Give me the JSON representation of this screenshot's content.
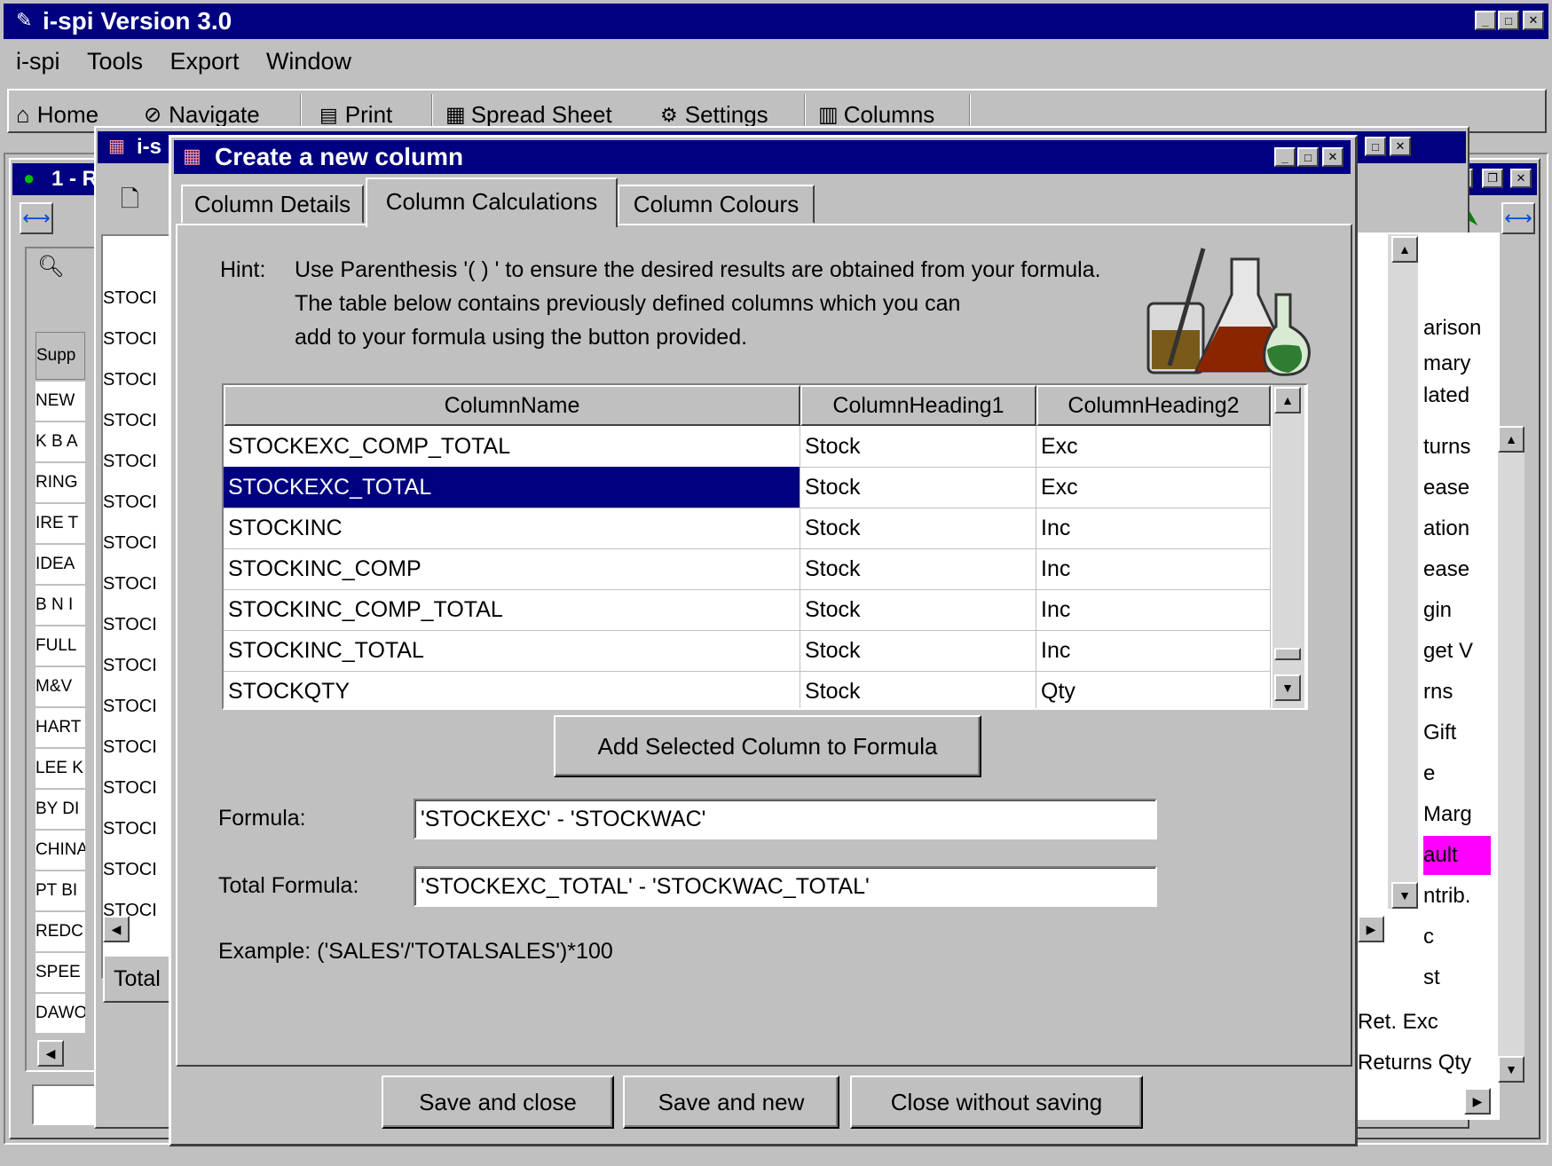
{
  "app": {
    "title": "i-spi Version 3.0",
    "menu": [
      "i-spi",
      "Tools",
      "Export",
      "Window"
    ],
    "toolbar": [
      "Home",
      "Navigate",
      "Print",
      "Spread Sheet",
      "Settings",
      "Columns"
    ]
  },
  "background": {
    "inner_window_title": "1 - R",
    "second_window_title": "i-s",
    "left_header": "Supp",
    "left_rows": [
      "NEW",
      "K B A",
      "RING",
      "IRE T",
      "IDEA",
      "B N I",
      "FULL",
      "M&V",
      "HART",
      "LEE K",
      "BY DI",
      "CHINA",
      "PT BI",
      "REDC",
      "SPEE",
      "DAWOO"
    ],
    "mid_rows": [
      "STOCI",
      "STOCI",
      "STOCI",
      "STOCI",
      "STOCI",
      "STOCI",
      "STOCI",
      "STOCI",
      "STOCI",
      "STOCI",
      "STOCI",
      "STOCI",
      "STOCI",
      "STOCI",
      "STOCI",
      "STOCI"
    ],
    "mid_total": "Total",
    "right_rows": [
      "arison",
      "mary",
      "lated",
      "turns",
      "ease",
      "ation",
      "ease",
      "gin",
      "get V",
      "rns",
      "Gift",
      "e",
      "Marg",
      "ault",
      "ntrib.",
      "c",
      "st",
      "Ret. Exc",
      "Returns Qty"
    ],
    "highlight_color": "#ff00ff"
  },
  "dialog": {
    "title": "Create a new column",
    "tabs": [
      "Column Details",
      "Column Calculations",
      "Column Colours"
    ],
    "active_tab": "Column Calculations",
    "hint_label": "Hint:",
    "hint_lines": [
      "Use Parenthesis '( ) ' to ensure the desired results are obtained from your formula.",
      "The table below contains previously defined columns which you can",
      "add to your formula using the button provided."
    ],
    "table": {
      "headers": [
        "ColumnName",
        "ColumnHeading1",
        "ColumnHeading2"
      ],
      "rows": [
        [
          "STOCKEXC_COMP_TOTAL",
          "Stock",
          "Exc"
        ],
        [
          "STOCKEXC_TOTAL",
          "Stock",
          "Exc"
        ],
        [
          "STOCKINC",
          "Stock",
          "Inc"
        ],
        [
          "STOCKINC_COMP",
          "Stock",
          "Inc"
        ],
        [
          "STOCKINC_COMP_TOTAL",
          "Stock",
          "Inc"
        ],
        [
          "STOCKINC_TOTAL",
          "Stock",
          "Inc"
        ],
        [
          "STOCKQTY",
          "Stock",
          "Qty"
        ]
      ],
      "selected_row": 1
    },
    "add_button": "Add Selected Column to Formula",
    "formula_label": "Formula:",
    "formula_value": "'STOCKEXC' - 'STOCKWAC'",
    "total_formula_label": "Total Formula:",
    "total_formula_value": "'STOCKEXC_TOTAL' - 'STOCKWAC_TOTAL'",
    "example": "Example: ('SALES'/'TOTALSALES')*100",
    "buttons": [
      "Save and close",
      "Save and new",
      "Close without saving"
    ]
  },
  "colors": {
    "title_bar": "#000080",
    "selection": "#000080",
    "face": "#c0c0c0"
  }
}
